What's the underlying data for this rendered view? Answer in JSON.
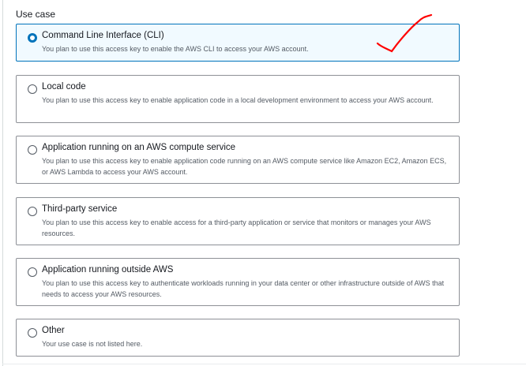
{
  "use_case": {
    "label": "Use case",
    "options": [
      {
        "title": "Command Line Interface (CLI)",
        "description": "You plan to use this access key to enable the AWS CLI to access your AWS account.",
        "selected": true
      },
      {
        "title": "Local code",
        "description": "You plan to use this access key to enable application code in a local development environment to access your AWS account.",
        "selected": false
      },
      {
        "title": "Application running on an AWS compute service",
        "description": "You plan to use this access key to enable application code running on an AWS compute service like Amazon EC2, Amazon ECS, or AWS Lambda to access your AWS account.",
        "selected": false
      },
      {
        "title": "Third-party service",
        "description": "You plan to use this access key to enable access for a third-party application or service that monitors or manages your AWS resources.",
        "selected": false
      },
      {
        "title": "Application running outside AWS",
        "description": "You plan to use this access key to authenticate workloads running in your data center or other infrastructure outside of AWS that needs to access your AWS resources.",
        "selected": false
      },
      {
        "title": "Other",
        "description": "Your use case is not listed here.",
        "selected": false
      }
    ]
  },
  "colors": {
    "accent": "#0073bb",
    "selected_bg": "#f1faff",
    "annotation": "#ff0000"
  }
}
